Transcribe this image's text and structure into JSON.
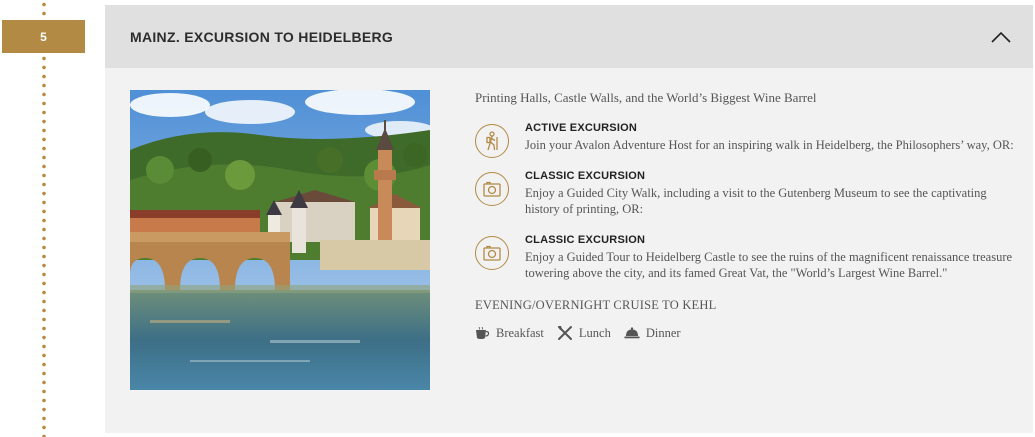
{
  "day": {
    "number": "5"
  },
  "header": {
    "title": "MAINZ. EXCURSION TO HEIDELBERG",
    "toggle_icon": "chevron-up-icon"
  },
  "main": {
    "subtitle": "Printing Halls, Castle Walls, and the World’s Biggest Wine Barrel",
    "excursions": [
      {
        "icon": "hiker-icon",
        "title": "ACTIVE EXCURSION",
        "description": "Join your Avalon Adventure Host for an inspiring walk in Heidelberg, the Philosophers’ way, OR:"
      },
      {
        "icon": "camera-icon",
        "title": "CLASSIC EXCURSION",
        "description": "Enjoy a Guided City Walk, including a visit to the Gutenberg Museum to see the captivating history of printing, OR:"
      },
      {
        "icon": "camera-icon",
        "title": "CLASSIC EXCURSION",
        "description": "Enjoy a Guided Tour to Heidelberg Castle to see the ruins of the magnificent renaissance treasure towering above the city, and its famed Great Vat, the \"World’s Largest Wine Barrel.\""
      }
    ],
    "evening": "EVENING/OVERNIGHT CRUISE TO KEHL",
    "meals": [
      {
        "icon": "coffee-cup-icon",
        "label": "Breakfast"
      },
      {
        "icon": "fork-knife-icon",
        "label": "Lunch"
      },
      {
        "icon": "cloche-icon",
        "label": "Dinner"
      }
    ]
  },
  "colors": {
    "accent": "#b28a44",
    "header_bg": "#e0e0e0",
    "panel_bg": "#f2f2f2"
  }
}
